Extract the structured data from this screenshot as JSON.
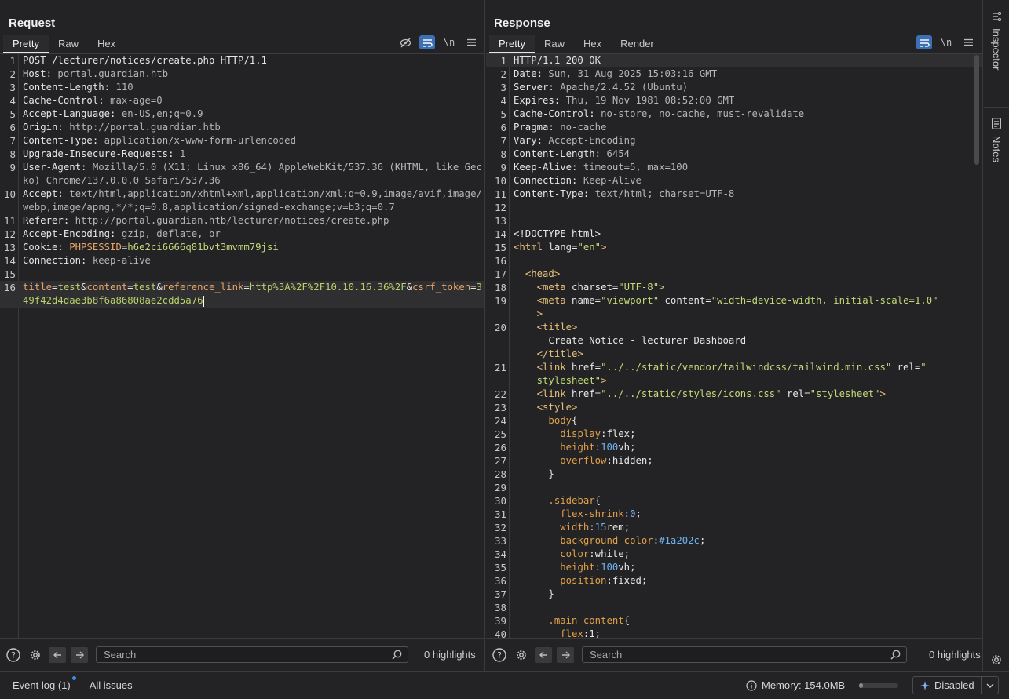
{
  "layout_toggle": {
    "modes": [
      "split-horizontal",
      "split-vertical",
      "single"
    ],
    "active": 0
  },
  "request": {
    "title": "Request",
    "tabs": [
      "Pretty",
      "Raw",
      "Hex"
    ],
    "active_tab": "Pretty",
    "tools": {
      "newline": "\\n"
    },
    "lines": [
      {
        "n": "1",
        "segs": [
          [
            "k",
            "POST /lecturer/notices/create.php HTTP/1.1"
          ]
        ]
      },
      {
        "n": "2",
        "segs": [
          [
            "k",
            "Host: "
          ],
          [
            "v",
            "portal.guardian.htb"
          ]
        ]
      },
      {
        "n": "3",
        "segs": [
          [
            "k",
            "Content-Length: "
          ],
          [
            "v",
            "110"
          ]
        ]
      },
      {
        "n": "4",
        "segs": [
          [
            "k",
            "Cache-Control: "
          ],
          [
            "v",
            "max-age=0"
          ]
        ]
      },
      {
        "n": "5",
        "segs": [
          [
            "k",
            "Accept-Language: "
          ],
          [
            "v",
            "en-US,en;q=0.9"
          ]
        ]
      },
      {
        "n": "6",
        "segs": [
          [
            "k",
            "Origin: "
          ],
          [
            "v",
            "http://portal.guardian.htb"
          ]
        ]
      },
      {
        "n": "7",
        "segs": [
          [
            "k",
            "Content-Type: "
          ],
          [
            "v",
            "application/x-www-form-urlencoded"
          ]
        ]
      },
      {
        "n": "8",
        "segs": [
          [
            "k",
            "Upgrade-Insecure-Requests: "
          ],
          [
            "v",
            "1"
          ]
        ]
      },
      {
        "n": "9",
        "segs": [
          [
            "k",
            "User-Agent: "
          ],
          [
            "v",
            "Mozilla/5.0 (X11; Linux x86_64) AppleWebKit/537.36 (KHTML, like Gecko) Chrome/137.0.0.0 Safari/537.36"
          ]
        ]
      },
      {
        "n": "10",
        "segs": [
          [
            "k",
            "Accept: "
          ],
          [
            "v",
            "text/html,application/xhtml+xml,application/xml;q=0.9,image/avif,image/webp,image/apng,*/*;q=0.8,application/signed-exchange;v=b3;q=0.7"
          ]
        ]
      },
      {
        "n": "11",
        "segs": [
          [
            "k",
            "Referer: "
          ],
          [
            "v",
            "http://portal.guardian.htb/lecturer/notices/create.php"
          ]
        ]
      },
      {
        "n": "12",
        "segs": [
          [
            "k",
            "Accept-Encoding: "
          ],
          [
            "v",
            "gzip, deflate, br"
          ]
        ]
      },
      {
        "n": "13",
        "segs": [
          [
            "k",
            "Cookie: "
          ],
          [
            "param",
            "PHPSESSID"
          ],
          [
            "v",
            "="
          ],
          [
            "cookie",
            "h6e2ci6666q81bvt3mvmm79jsi"
          ]
        ]
      },
      {
        "n": "14",
        "segs": [
          [
            "k",
            "Connection: "
          ],
          [
            "v",
            "keep-alive"
          ]
        ]
      },
      {
        "n": "15",
        "segs": []
      },
      {
        "n": "16",
        "segs": [
          [
            "param",
            "title"
          ],
          [
            "k",
            "="
          ],
          [
            "pval",
            "test"
          ],
          [
            "k",
            "&"
          ],
          [
            "param",
            "content"
          ],
          [
            "k",
            "="
          ],
          [
            "pval",
            "test"
          ],
          [
            "k",
            "&"
          ],
          [
            "param",
            "reference_link"
          ],
          [
            "k",
            "="
          ],
          [
            "pval",
            "http%3A%2F%2F10.10.16.36%2F"
          ],
          [
            "k",
            "&"
          ],
          [
            "param",
            "csrf_token"
          ],
          [
            "k",
            "="
          ],
          [
            "pval",
            "349f42d4dae3b8f6a86808ae2cdd5a76"
          ]
        ],
        "caret": true,
        "highlight": true
      }
    ],
    "search": {
      "placeholder": "Search",
      "highlights": "0 highlights"
    }
  },
  "response": {
    "title": "Response",
    "tabs": [
      "Pretty",
      "Raw",
      "Hex",
      "Render"
    ],
    "active_tab": "Pretty",
    "tools": {
      "newline": "\\n"
    },
    "lines": [
      {
        "n": "1",
        "segs": [
          [
            "k",
            "HTTP/1.1 200 OK"
          ]
        ],
        "highlight": true
      },
      {
        "n": "2",
        "segs": [
          [
            "k",
            "Date: "
          ],
          [
            "v",
            "Sun, 31 Aug 2025 15:03:16 GMT"
          ]
        ]
      },
      {
        "n": "3",
        "segs": [
          [
            "k",
            "Server: "
          ],
          [
            "v",
            "Apache/2.4.52 (Ubuntu)"
          ]
        ]
      },
      {
        "n": "4",
        "segs": [
          [
            "k",
            "Expires: "
          ],
          [
            "v",
            "Thu, 19 Nov 1981 08:52:00 GMT"
          ]
        ]
      },
      {
        "n": "5",
        "segs": [
          [
            "k",
            "Cache-Control: "
          ],
          [
            "v",
            "no-store, no-cache, must-revalidate"
          ]
        ]
      },
      {
        "n": "6",
        "segs": [
          [
            "k",
            "Pragma: "
          ],
          [
            "v",
            "no-cache"
          ]
        ]
      },
      {
        "n": "7",
        "segs": [
          [
            "k",
            "Vary: "
          ],
          [
            "v",
            "Accept-Encoding"
          ]
        ]
      },
      {
        "n": "8",
        "segs": [
          [
            "k",
            "Content-Length: "
          ],
          [
            "v",
            "6454"
          ]
        ]
      },
      {
        "n": "9",
        "segs": [
          [
            "k",
            "Keep-Alive: "
          ],
          [
            "v",
            "timeout=5, max=100"
          ]
        ]
      },
      {
        "n": "10",
        "segs": [
          [
            "k",
            "Connection: "
          ],
          [
            "v",
            "Keep-Alive"
          ]
        ]
      },
      {
        "n": "11",
        "segs": [
          [
            "k",
            "Content-Type: "
          ],
          [
            "v",
            "text/html; charset=UTF-8"
          ]
        ]
      },
      {
        "n": "12",
        "segs": []
      },
      {
        "n": "13",
        "segs": []
      },
      {
        "n": "14",
        "segs": [
          [
            "k",
            "<!DOCTYPE html>"
          ]
        ]
      },
      {
        "n": "15",
        "segs": [
          [
            "tag",
            "<html "
          ],
          [
            "attr",
            "lang"
          ],
          [
            "k",
            "="
          ],
          [
            "str",
            "\"en\""
          ],
          [
            "tag",
            ">"
          ]
        ]
      },
      {
        "n": "16",
        "segs": []
      },
      {
        "n": "17",
        "segs": [
          [
            "k",
            "  "
          ],
          [
            "tag",
            "<head>"
          ]
        ]
      },
      {
        "n": "18",
        "segs": [
          [
            "k",
            "    "
          ],
          [
            "tag",
            "<meta "
          ],
          [
            "attr",
            "charset"
          ],
          [
            "k",
            "="
          ],
          [
            "str",
            "\"UTF-8\""
          ],
          [
            "tag",
            ">"
          ]
        ]
      },
      {
        "n": "19",
        "segs": [
          [
            "k",
            "    "
          ],
          [
            "tag",
            "<meta "
          ],
          [
            "attr",
            "name"
          ],
          [
            "k",
            "="
          ],
          [
            "str",
            "\"viewport\""
          ],
          [
            "attr",
            " content"
          ],
          [
            "k",
            "="
          ],
          [
            "str",
            "\"width=device-width, initial-scale=1.0\""
          ],
          [
            "tag",
            "\n    >"
          ]
        ]
      },
      {
        "n": "20",
        "segs": [
          [
            "k",
            "    "
          ],
          [
            "tag",
            "<title>"
          ],
          [
            "k",
            "\n      Create Notice - lecturer Dashboard\n    "
          ],
          [
            "tag",
            "</title>"
          ]
        ]
      },
      {
        "n": "21",
        "segs": [
          [
            "k",
            "    "
          ],
          [
            "tag",
            "<link "
          ],
          [
            "attr",
            "href"
          ],
          [
            "k",
            "="
          ],
          [
            "str",
            "\"../../static/vendor/tailwindcss/tailwind.min.css\""
          ],
          [
            "attr",
            " rel"
          ],
          [
            "k",
            "="
          ],
          [
            "str",
            "\"\n    stylesheet\""
          ],
          [
            "tag",
            ">"
          ]
        ]
      },
      {
        "n": "22",
        "segs": [
          [
            "k",
            "    "
          ],
          [
            "tag",
            "<link "
          ],
          [
            "attr",
            "href"
          ],
          [
            "k",
            "="
          ],
          [
            "str",
            "\"../../static/styles/icons.css\""
          ],
          [
            "attr",
            " rel"
          ],
          [
            "k",
            "="
          ],
          [
            "str",
            "\"stylesheet\""
          ],
          [
            "tag",
            ">"
          ]
        ]
      },
      {
        "n": "23",
        "segs": [
          [
            "k",
            "    "
          ],
          [
            "tag",
            "<style>"
          ]
        ]
      },
      {
        "n": "24",
        "segs": [
          [
            "k",
            "      "
          ],
          [
            "sel",
            "body"
          ],
          [
            "k",
            "{"
          ]
        ]
      },
      {
        "n": "25",
        "segs": [
          [
            "k",
            "        "
          ],
          [
            "prop",
            "display"
          ],
          [
            "k",
            ":flex;"
          ]
        ]
      },
      {
        "n": "26",
        "segs": [
          [
            "k",
            "        "
          ],
          [
            "prop",
            "height"
          ],
          [
            "k",
            ":"
          ],
          [
            "num",
            "100"
          ],
          [
            "k",
            "vh;"
          ]
        ]
      },
      {
        "n": "27",
        "segs": [
          [
            "k",
            "        "
          ],
          [
            "prop",
            "overflow"
          ],
          [
            "k",
            ":hidden;"
          ]
        ]
      },
      {
        "n": "28",
        "segs": [
          [
            "k",
            "      }"
          ]
        ]
      },
      {
        "n": "29",
        "segs": []
      },
      {
        "n": "30",
        "segs": [
          [
            "k",
            "      "
          ],
          [
            "sel",
            ".sidebar"
          ],
          [
            "k",
            "{"
          ]
        ]
      },
      {
        "n": "31",
        "segs": [
          [
            "k",
            "        "
          ],
          [
            "prop",
            "flex-shrink"
          ],
          [
            "k",
            ":"
          ],
          [
            "num",
            "0"
          ],
          [
            "k",
            ";"
          ]
        ]
      },
      {
        "n": "32",
        "segs": [
          [
            "k",
            "        "
          ],
          [
            "prop",
            "width"
          ],
          [
            "k",
            ":"
          ],
          [
            "num",
            "15"
          ],
          [
            "k",
            "rem;"
          ]
        ]
      },
      {
        "n": "33",
        "segs": [
          [
            "k",
            "        "
          ],
          [
            "prop",
            "background-color"
          ],
          [
            "k",
            ":"
          ],
          [
            "num",
            "#1a202c"
          ],
          [
            "k",
            ";"
          ]
        ]
      },
      {
        "n": "34",
        "segs": [
          [
            "k",
            "        "
          ],
          [
            "prop",
            "color"
          ],
          [
            "k",
            ":white;"
          ]
        ]
      },
      {
        "n": "35",
        "segs": [
          [
            "k",
            "        "
          ],
          [
            "prop",
            "height"
          ],
          [
            "k",
            ":"
          ],
          [
            "num",
            "100"
          ],
          [
            "k",
            "vh;"
          ]
        ]
      },
      {
        "n": "36",
        "segs": [
          [
            "k",
            "        "
          ],
          [
            "prop",
            "position"
          ],
          [
            "k",
            ":fixed;"
          ]
        ]
      },
      {
        "n": "37",
        "segs": [
          [
            "k",
            "      }"
          ]
        ]
      },
      {
        "n": "38",
        "segs": []
      },
      {
        "n": "39",
        "segs": [
          [
            "k",
            "      "
          ],
          [
            "sel",
            ".main-content"
          ],
          [
            "k",
            "{"
          ]
        ]
      },
      {
        "n": "40",
        "segs": [
          [
            "k",
            "        "
          ],
          [
            "prop",
            "flex"
          ],
          [
            "k",
            ":1;"
          ]
        ]
      }
    ],
    "search": {
      "placeholder": "Search",
      "highlights": "0 highlights"
    }
  },
  "sidebar": {
    "tabs": [
      "Inspector",
      "Notes"
    ]
  },
  "statusbar": {
    "event_log": "Event log (1)",
    "all_issues": "All issues",
    "memory": "Memory: 154.0MB",
    "memory_usage": 0.1,
    "ai_label": "Disabled"
  },
  "colors": {
    "accent": "#3d6fb5",
    "background": "#232325"
  }
}
